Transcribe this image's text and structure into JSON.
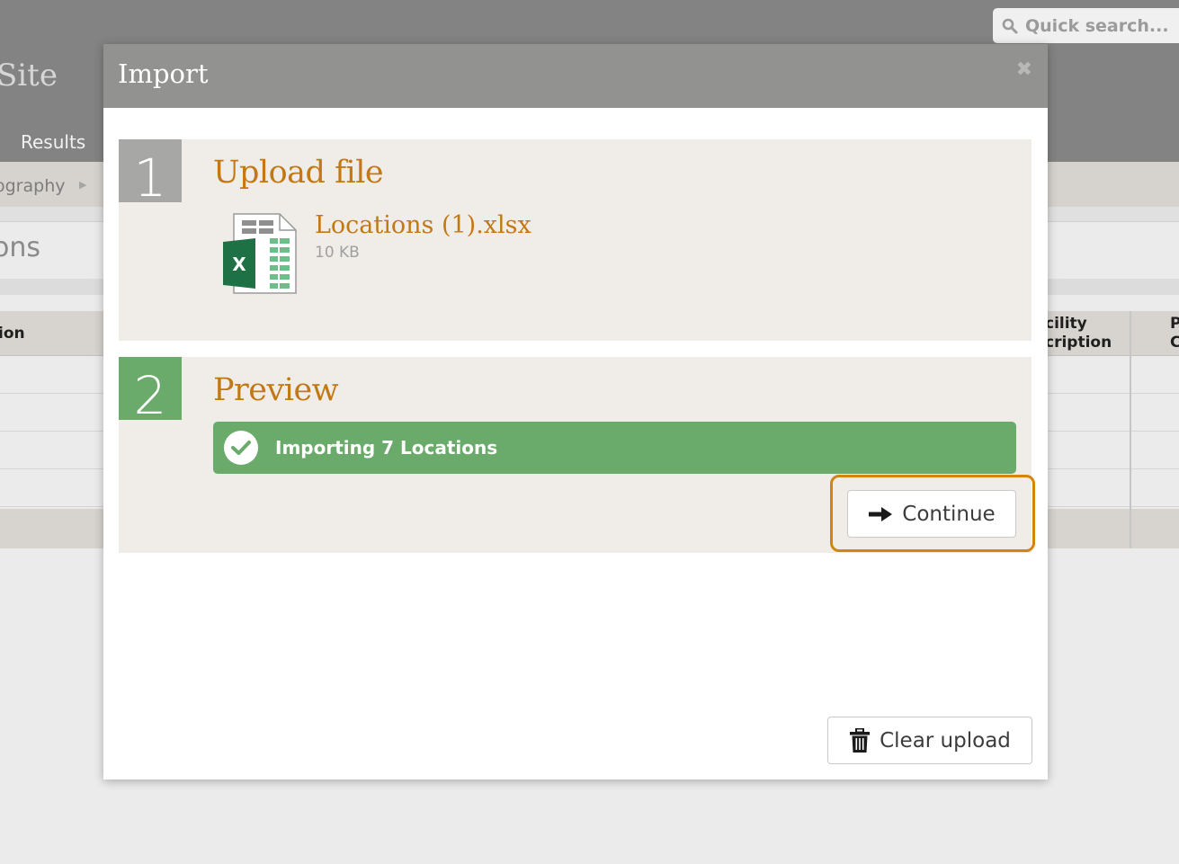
{
  "background": {
    "site_title": "Site",
    "nav_results": "Results",
    "search_placeholder": "Quick search...",
    "breadcrumb_text": "ography",
    "page_title": "ons",
    "table_headers": {
      "col1": "ion",
      "col2_line1": "cility",
      "col2_line2": "cription",
      "col3_line1": "P",
      "col3_line2": "C"
    }
  },
  "modal": {
    "title": "Import",
    "close_symbol": "✖",
    "step1": {
      "number": "1",
      "title": "Upload file",
      "file_name": "Locations (1).xlsx",
      "file_size": "10 KB"
    },
    "step2": {
      "number": "2",
      "title": "Preview",
      "status_text": "Importing 7 Locations"
    },
    "buttons": {
      "continue": "Continue",
      "clear_upload": "Clear upload"
    }
  },
  "icons": {
    "search": "search-icon",
    "close": "close-icon",
    "excel": "excel-file-icon",
    "check": "check-circle-icon",
    "arrow": "arrow-right-icon",
    "trash": "trash-icon"
  },
  "colors": {
    "accent_orange": "#c27813",
    "success_green": "#6aaa6a",
    "highlight_outline": "#d0860f"
  }
}
